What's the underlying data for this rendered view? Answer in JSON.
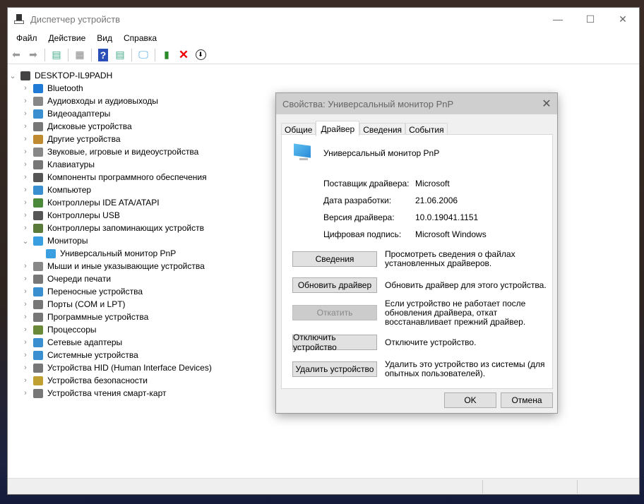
{
  "window": {
    "title": "Диспетчер устройств",
    "controls": [
      "—",
      "☐",
      "✕"
    ]
  },
  "menu": [
    "Файл",
    "Действие",
    "Вид",
    "Справка"
  ],
  "toolbar": {
    "icons": [
      "back-icon",
      "forward-icon",
      "properties-pane-icon",
      "show-hide-icon",
      "help-icon",
      "action-pane-icon",
      "scan-hardware-icon",
      "update-driver-icon",
      "uninstall-icon",
      "disable-icon"
    ]
  },
  "tree": {
    "root": "DESKTOP-IL9PADH",
    "items": [
      {
        "label": "Bluetooth",
        "color": "#1e7ad4"
      },
      {
        "label": "Аудиовходы и аудиовыходы",
        "color": "#888"
      },
      {
        "label": "Видеоадаптеры",
        "color": "#3a8fd0"
      },
      {
        "label": "Дисковые устройства",
        "color": "#777"
      },
      {
        "label": "Другие устройства",
        "color": "#c08a30"
      },
      {
        "label": "Звуковые, игровые и видеоустройства",
        "color": "#888"
      },
      {
        "label": "Клавиатуры",
        "color": "#777"
      },
      {
        "label": "Компоненты программного обеспечения",
        "color": "#555"
      },
      {
        "label": "Компьютер",
        "color": "#3a8fd0"
      },
      {
        "label": "Контроллеры IDE ATA/ATAPI",
        "color": "#4a8a3a"
      },
      {
        "label": "Контроллеры USB",
        "color": "#555"
      },
      {
        "label": "Контроллеры запоминающих устройств",
        "color": "#5a7a3a"
      },
      {
        "label": "Мониторы",
        "color": "#3a9fe0",
        "expanded": true
      },
      {
        "label": "Универсальный монитор PnP",
        "color": "#3a9fe0",
        "child": true
      },
      {
        "label": "Мыши и иные указывающие устройства",
        "color": "#888"
      },
      {
        "label": "Очереди печати",
        "color": "#777"
      },
      {
        "label": "Переносные устройства",
        "color": "#3a8fd0"
      },
      {
        "label": "Порты (COM и LPT)",
        "color": "#777"
      },
      {
        "label": "Программные устройства",
        "color": "#777"
      },
      {
        "label": "Процессоры",
        "color": "#6a8a3a"
      },
      {
        "label": "Сетевые адаптеры",
        "color": "#3a8fd0"
      },
      {
        "label": "Системные устройства",
        "color": "#3a8fd0"
      },
      {
        "label": "Устройства HID (Human Interface Devices)",
        "color": "#777"
      },
      {
        "label": "Устройства безопасности",
        "color": "#c0a030"
      },
      {
        "label": "Устройства чтения смарт-карт",
        "color": "#777"
      }
    ]
  },
  "dialog": {
    "title": "Свойства: Универсальный монитор PnP",
    "close": "✕",
    "tabs": [
      "Общие",
      "Драйвер",
      "Сведения",
      "События"
    ],
    "device_name": "Универсальный монитор PnP",
    "fields": [
      {
        "k": "Поставщик драйвера:",
        "v": "Microsoft"
      },
      {
        "k": "Дата разработки:",
        "v": "21.06.2006"
      },
      {
        "k": "Версия драйвера:",
        "v": "10.0.19041.1151"
      },
      {
        "k": "Цифровая подпись:",
        "v": "Microsoft Windows"
      }
    ],
    "actions": [
      {
        "label": "Сведения",
        "desc": "Просмотреть сведения о файлах установленных драйверов."
      },
      {
        "label": "Обновить драйвер",
        "desc": "Обновить драйвер для этого устройства."
      },
      {
        "label": "Откатить",
        "desc": "Если устройство не работает после обновления драйвера, откат восстанавливает прежний драйвер.",
        "disabled": true
      },
      {
        "label": "Отключить устройство",
        "desc": "Отключите устройство."
      },
      {
        "label": "Удалить устройство",
        "desc": "Удалить это устройство из системы (для опытных пользователей)."
      }
    ],
    "ok": "OK",
    "cancel": "Отмена"
  }
}
